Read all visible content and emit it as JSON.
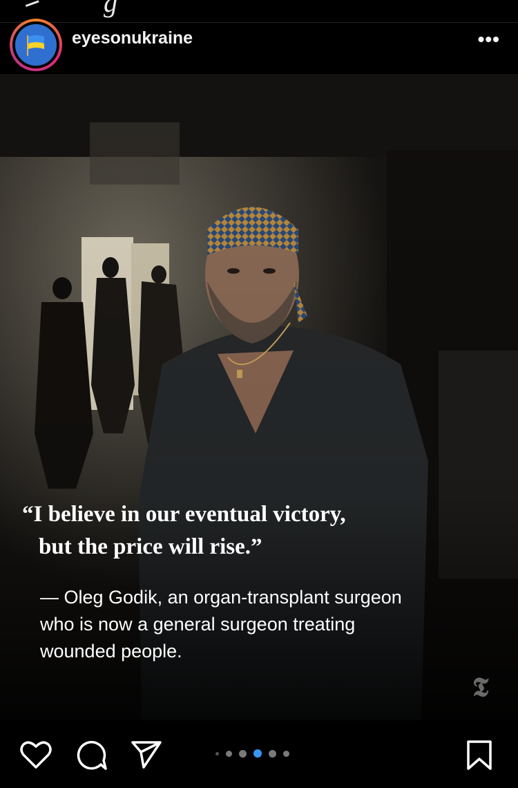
{
  "post": {
    "username": "eyesonukraine",
    "more_label": "•••"
  },
  "image": {
    "quote_line1": "“I believe in our eventual victory,",
    "quote_line2": "but the price will rise.”",
    "attribution_line1": "— Oleg Godik, an organ-transplant surgeon",
    "attribution_line2": "who is now a general surgeon treating",
    "attribution_line3": "wounded people.",
    "watermark": "𝕿"
  },
  "carousel": {
    "count": 6,
    "active_index": 3
  },
  "icons": {
    "like": "heart-icon",
    "comment": "comment-icon",
    "share": "send-icon",
    "save": "bookmark-icon",
    "more": "more-icon"
  },
  "colors": {
    "accent_blue": "#3897f0",
    "background": "#000000"
  }
}
